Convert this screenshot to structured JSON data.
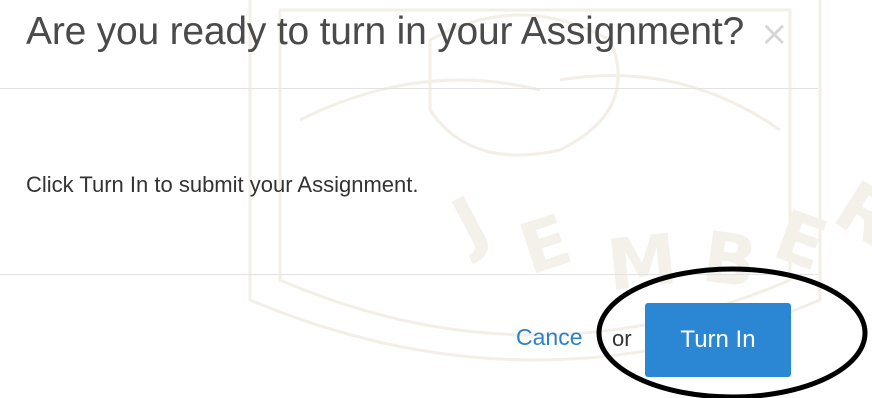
{
  "modal": {
    "title": "Are you ready to turn in your Assignment?",
    "close_icon": "close-icon",
    "body_text": "Click Turn In to submit your Assignment.",
    "footer": {
      "cancel_label": "Cance",
      "or_text": "or",
      "turn_in_label": "Turn In"
    }
  },
  "colors": {
    "primary_button": "#2b87d3",
    "link": "#2d82c7",
    "title_text": "#4a4a4a",
    "annotation_ring": "#000000"
  }
}
